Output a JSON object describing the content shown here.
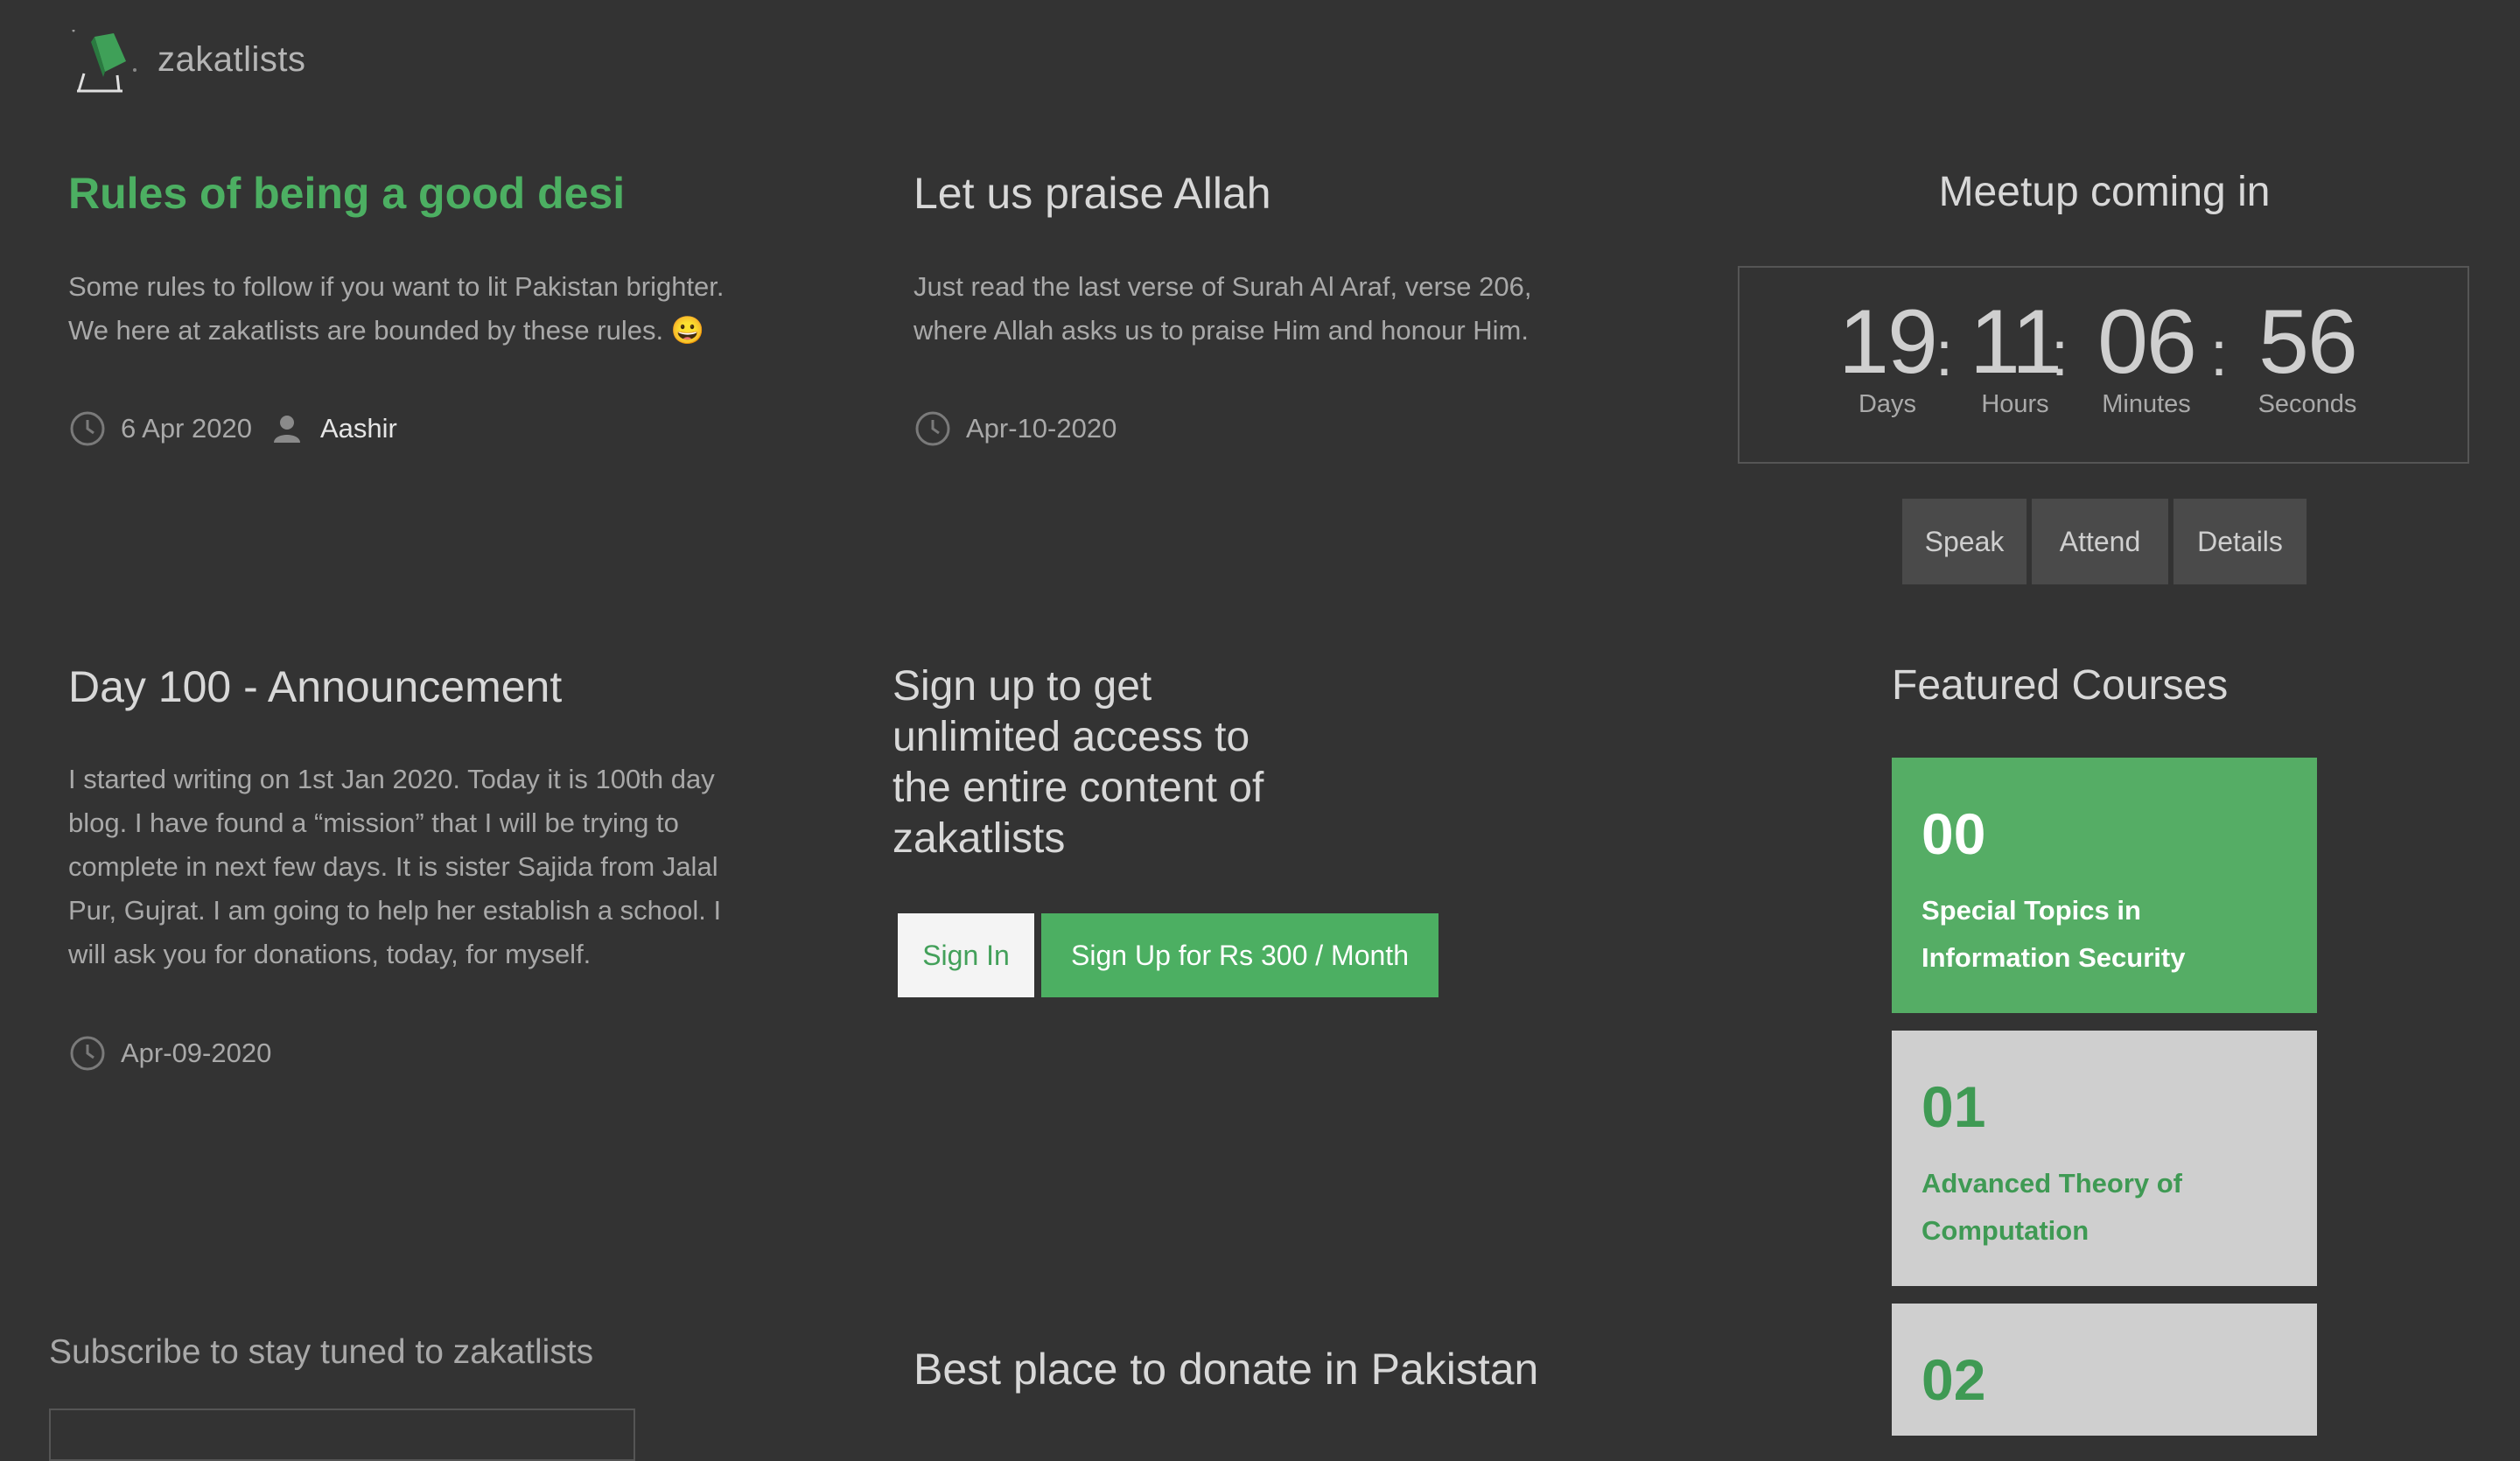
{
  "header": {
    "brand": "zakatlists"
  },
  "posts": [
    {
      "title": "Rules of being a good desi",
      "excerpt": "Some rules to follow if you want to lit Pakistan brighter. We here at zakatlists are bounded by these rules. 😀",
      "date": "6 Apr 2020",
      "author": "Aashir"
    },
    {
      "title": "Let us praise Allah",
      "excerpt": "Just read the last verse of Surah Al Araf, verse 206, where Allah asks us to praise Him and honour Him.",
      "date": "Apr-10-2020"
    },
    {
      "title": "Day 100 - Announcement",
      "excerpt": "I started writing on 1st Jan 2020. Today it is 100th day blog. I have found a “mission” that I will be trying to complete in next few days. It is sister Sajida from Jalal Pur, Gujrat. I am going to help her establish a school. I will ask you for donations, today, for myself.",
      "date": "Apr-09-2020"
    }
  ],
  "meetup": {
    "title": "Meetup coming in",
    "days": "19",
    "hours": "11",
    "minutes": "06",
    "seconds": "56",
    "days_label": "Days",
    "hours_label": "Hours",
    "minutes_label": "Minutes",
    "seconds_label": "Seconds",
    "separator": ":",
    "speak_label": "Speak",
    "attend_label": "Attend",
    "details_label": "Details"
  },
  "signup": {
    "text": "Sign up to get unlimited access to the entire content of zakatlists",
    "signin_label": "Sign In",
    "signup_label": "Sign Up for Rs 300 / Month"
  },
  "featured": {
    "title": "Featured Courses",
    "courses": [
      {
        "num": "00",
        "name": "Special Topics in Information Security"
      },
      {
        "num": "01",
        "name": "Advanced Theory of Computation"
      },
      {
        "num": "02",
        "name": ""
      }
    ]
  },
  "footer": {
    "subscribe_title": "Subscribe to stay tuned to zakatlists",
    "donate_title": "Best place to donate in Pakistan"
  },
  "colors": {
    "accent": "#4caf62",
    "background": "#333333",
    "card_light": "#cfcfcf"
  },
  "icons": {
    "logo": "book-logo-icon",
    "clock": "clock-icon",
    "user": "user-icon"
  }
}
